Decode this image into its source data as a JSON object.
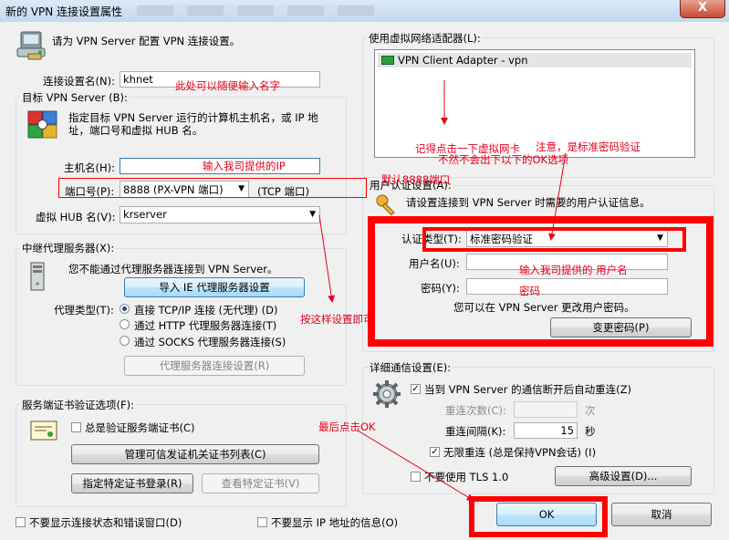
{
  "window": {
    "title": "新的 VPN 连接设置属性",
    "close_glyph": "X"
  },
  "intro": {
    "text": "请为 VPN Server 配置 VPN 连接设置。"
  },
  "conn_name": {
    "label": "连接设置名(N):",
    "value": "khnet"
  },
  "target": {
    "group_label": "目标 VPN Server (B):",
    "desc_line1": "指定目标 VPN Server 运行的计算机主机名，或 IP 地",
    "desc_line2": "址，端口号和虚拟 HUB 名。",
    "host_label": "主机名(H):",
    "host_value": "",
    "port_label": "端口号(P):",
    "port_value": "8888 (PX-VPN 端口)",
    "port_suffix": "(TCP 端口)",
    "hub_label": "虚拟 HUB 名(V):",
    "hub_value": "krserver"
  },
  "proxy": {
    "group_label": "中继代理服务器(X):",
    "desc": "您不能通过代理服务器连接到 VPN Server。",
    "import_button": "导入 IE 代理服务器设置",
    "type_label": "代理类型(T):",
    "options": [
      "直接 TCP/IP 连接 (无代理) (D)",
      "通过 HTTP 代理服务器连接(T)",
      "通过 SOCKS 代理服务器连接(S)"
    ],
    "settings_button": "代理服务器连接设置(R)"
  },
  "cert": {
    "group_label": "服务端证书验证选项(F):",
    "always_verify": "总是验证服务端证书(C)",
    "manage_button": "管理可信发证机关证书列表(C)",
    "specify_button": "指定特定证书登录(R)",
    "view_button": "查看特定证书(V)"
  },
  "adapter": {
    "group_label": "使用虚拟网络适配器(L):",
    "item": "VPN Client Adapter - vpn"
  },
  "auth": {
    "group_label": "用户认证设置(A):",
    "desc": "请设置连接到 VPN Server 时需要的用户认证信息。",
    "type_label": "认证类型(T):",
    "type_value": "标准密码验证",
    "user_label": "用户名(U):",
    "pass_label": "密码(Y):",
    "note": "您可以在 VPN Server 更改用户密码。",
    "change_button": "变更密码(P)"
  },
  "advanced": {
    "group_label": "详细通信设置(E):",
    "auto_reconnect": "当到 VPN Server 的通信断开后自动重连(Z)",
    "retry_label": "重连次数(C):",
    "retry_unit": "次",
    "interval_label": "重连间隔(K):",
    "interval_value": "15",
    "interval_unit": "秒",
    "infinite": "无限重连 (总是保持VPN会话) (I)",
    "no_tls": "不要使用 TLS 1.0",
    "adv_button": "高级设置(D)..."
  },
  "bottom": {
    "no_status": "不要显示连接状态和错误窗口(D)",
    "no_ip": "不要显示 IP 地址的信息(O)"
  },
  "actions": {
    "ok": "OK",
    "cancel": "取消"
  },
  "annotations": {
    "name_hint": "此处可以随便输入名字",
    "host_hint": "输入我司提供的IP",
    "port_hint": "默认8888端口",
    "proxy_hint": "按这样设置即可",
    "adapter_hint1": "记得点击一下虚拟网卡",
    "adapter_hint2": "不然不会出下以下的OK选项",
    "auth_hint": "注意，是标准密码验证",
    "user_hint": "输入我司提供的 用户名",
    "pass_hint": "密码",
    "ok_hint": "最后点击OK"
  },
  "colors": {
    "annotation": "#e8001b",
    "highlight_box": "#ff0000"
  }
}
